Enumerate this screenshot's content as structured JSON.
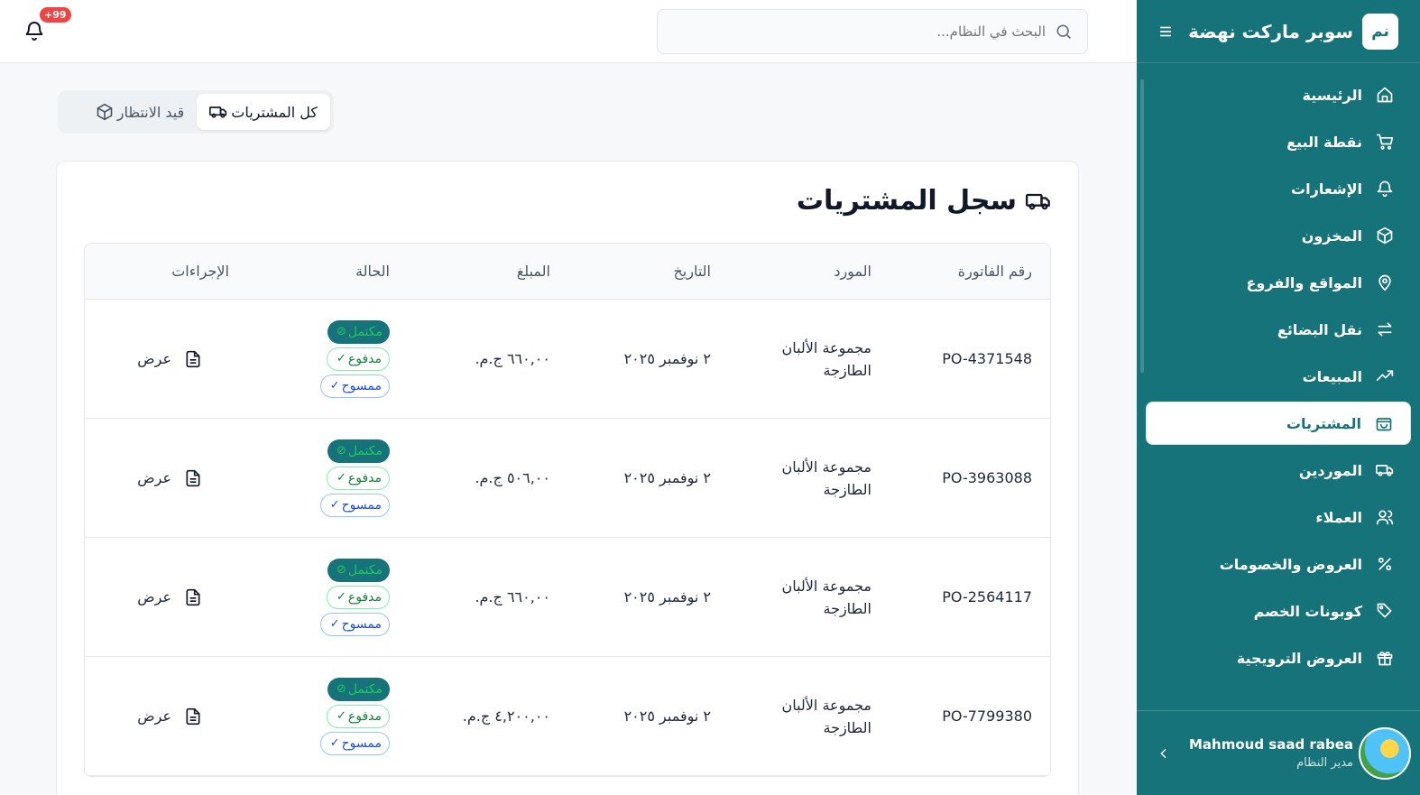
{
  "sidebar": {
    "logo_text": "نم",
    "app_title": "سوبر ماركت نهضة",
    "items": [
      {
        "label": "الرئيسية",
        "icon": "home-icon"
      },
      {
        "label": "نقطة البيع",
        "icon": "cart-icon"
      },
      {
        "label": "الإشعارات",
        "icon": "bell-icon"
      },
      {
        "label": "المخزون",
        "icon": "box-icon"
      },
      {
        "label": "المواقع والفروع",
        "icon": "map-pin-icon"
      },
      {
        "label": "نقل البضائع",
        "icon": "transfer-icon"
      },
      {
        "label": "المبيعات",
        "icon": "trending-up-icon"
      },
      {
        "label": "المشتريات",
        "icon": "shopping-bag-icon",
        "active": true
      },
      {
        "label": "الموردين",
        "icon": "truck-icon"
      },
      {
        "label": "العملاء",
        "icon": "users-icon"
      },
      {
        "label": "العروض والخصومات",
        "icon": "percent-icon"
      },
      {
        "label": "كوبونات الخصم",
        "icon": "tag-icon"
      },
      {
        "label": "العروض الترويجية",
        "icon": "gift-icon"
      }
    ],
    "user": {
      "name": "Mahmoud saad rabea",
      "role": "مدير النظام"
    }
  },
  "topbar": {
    "search_placeholder": "البحث في النظام...",
    "notification_count": "+99"
  },
  "tabs": [
    {
      "label": "كل المشتريات",
      "icon": "truck-icon",
      "active": true
    },
    {
      "label": "قيد الانتظار",
      "icon": "package-icon",
      "active": false
    }
  ],
  "card": {
    "title": "سجل المشتريات",
    "columns": [
      "رقم الفاتورة",
      "المورد",
      "التاريخ",
      "المبلغ",
      "الحالة",
      "الإجراءات"
    ],
    "rows": [
      {
        "invoice": "PO-4371548",
        "supplier": "مجموعة الألبان الطازجة",
        "date": "٢ نوفمبر ٢٠٢٥",
        "amount": "٦٦٠,٠٠ ج.م.",
        "status_complete": "مكتمل",
        "status_paid": "مدفوع",
        "status_scanned": "ممسوح",
        "action": "عرض"
      },
      {
        "invoice": "PO-3963088",
        "supplier": "مجموعة الألبان الطازجة",
        "date": "٢ نوفمبر ٢٠٢٥",
        "amount": "٥٠٦,٠٠ ج.م.",
        "status_complete": "مكتمل",
        "status_paid": "مدفوع",
        "status_scanned": "ممسوح",
        "action": "عرض"
      },
      {
        "invoice": "PO-2564117",
        "supplier": "مجموعة الألبان الطازجة",
        "date": "٢ نوفمبر ٢٠٢٥",
        "amount": "٦٦٠,٠٠ ج.م.",
        "status_complete": "مكتمل",
        "status_paid": "مدفوع",
        "status_scanned": "ممسوح",
        "action": "عرض"
      },
      {
        "invoice": "PO-7799380",
        "supplier": "مجموعة الألبان الطازجة",
        "date": "٢ نوفمبر ٢٠٢٥",
        "amount": "٤,٢٠٠,٠٠ ج.م.",
        "status_complete": "مكتمل",
        "status_paid": "مدفوع",
        "status_scanned": "ممسوح",
        "action": "عرض"
      }
    ]
  },
  "colors": {
    "primary": "#17737a",
    "badge": "#ef4444",
    "paid": "#15803d",
    "scanned": "#1d4ed8",
    "complete_text": "#22c55e"
  }
}
